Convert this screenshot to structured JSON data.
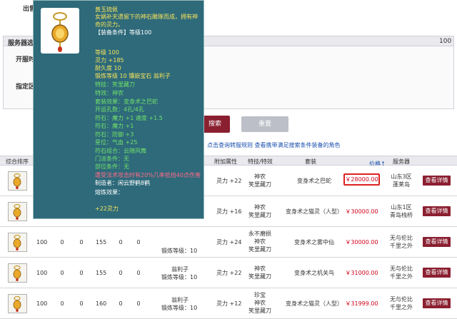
{
  "search": {
    "row1_label": "出售",
    "panel_title": "服务器选",
    "panel_right": "100",
    "row2_label": "开服时",
    "row3_label": "指定区",
    "search_button": "搜索",
    "reset_button": "重置",
    "hint_text": "点击查询转服规则  查看携带满足搜索条件装备的角色"
  },
  "table": {
    "headers": {
      "sort": "综合排序",
      "attr": "附加属性",
      "special": "特技/特效",
      "suit": "套装",
      "price": "价格↑",
      "server": "服务器"
    },
    "rows": [
      {
        "c1": "",
        "c2": "",
        "c3": "",
        "c4": "",
        "c5": "",
        "c6": "",
        "forge": "",
        "attr": "灵力 +22",
        "special": [
          "神农",
          "笑里藏刀"
        ],
        "suit": "变身术之巴蛇",
        "price": "￥28000.00",
        "server": [
          "山东3区",
          "蓬莱岛"
        ],
        "detail": "查看详情"
      },
      {
        "c1": "",
        "c2": "",
        "c3": "",
        "c4": "",
        "c5": "",
        "c6": "",
        "forge": "",
        "attr": "灵力 +16",
        "special": [
          "神农",
          "笑里藏刀"
        ],
        "suit": "变身术之猫灵（人型）",
        "price": "￥30000.00",
        "server": [
          "山东1区",
          "青岛栈桥"
        ],
        "detail": "查看详情"
      },
      {
        "c1": "100",
        "c2": "0",
        "c3": "0",
        "c4": "155",
        "c5": "0",
        "c6": "0",
        "forge": "锻炼等级：10",
        "attr": "灵力 +24",
        "special": [
          "永不磨损",
          "神农",
          "笑里藏刀"
        ],
        "suit": "变身术之雾中仙",
        "price": "￥30000.00",
        "server": [
          "无与伦比",
          "千里之外"
        ],
        "detail": "查看详情"
      },
      {
        "c1": "100",
        "c2": "0",
        "c3": "0",
        "c4": "155",
        "c5": "0",
        "c6": "0",
        "forge": "锻炼等级：10",
        "gem": "翁利子",
        "attr": "灵力 +22",
        "special": [
          "神农",
          "笑里藏刀"
        ],
        "suit": "变身术之机关鸟",
        "price": "￥31000.00",
        "server": [
          "无与伦比",
          "千里之外"
        ],
        "detail": "查看详情"
      },
      {
        "c1": "100",
        "c2": "0",
        "c3": "0",
        "c4": "160",
        "c5": "0",
        "c6": "0",
        "forge": "锻炼等级：10",
        "gem": "翁利子",
        "attr": "灵力 +12",
        "special": [
          "珍宝",
          "神农",
          "笑里藏刀"
        ],
        "suit": "变身术之猫灵（人型）",
        "price": "￥31999.00",
        "server": [
          "无与伦比",
          "千里之外"
        ],
        "detail": "查看详情"
      }
    ]
  },
  "tooltip": {
    "name": "黄玉琉佩",
    "desc1": "女娲补天遗留下的神石雕琢而成，拥有神",
    "desc2": "奇的灵力。",
    "req": "【装备条件】等级100",
    "level": "等级 100",
    "spirit": "灵力 +185",
    "durability": "耐久度 10",
    "forge": "锻炼等级 10 镶嵌宝石 翁利子",
    "skill": "特技：笑里藏刀",
    "effect": "特效：神农",
    "suit": "套装效果：变身术之巴蛇",
    "holes": "开运孔数：4孔/4孔",
    "stone1": "符石：魔力 +1 速度 +1.5",
    "stone2": "符石：魔力 +1",
    "stone3": "符石：防御 +3",
    "star": "星位：气血 +25",
    "combo": "符石组合：云随风舞",
    "sect": "门派条件：无",
    "part": "部位条件：无",
    "bonus": "遭受法术攻击时有20%几率抵挡40点伤害",
    "maker": "制造者：闲云野鹤8鹤",
    "melt_label": "熔炼效果：",
    "melt": "+22灵力"
  },
  "colors": {
    "tooltip_bg": "#2e6a7a",
    "button": "#8a1f30",
    "price": "#d0021b",
    "highlight": "#e0201f",
    "yellow_text": "#f6e35c",
    "green_text": "#72e16a"
  }
}
